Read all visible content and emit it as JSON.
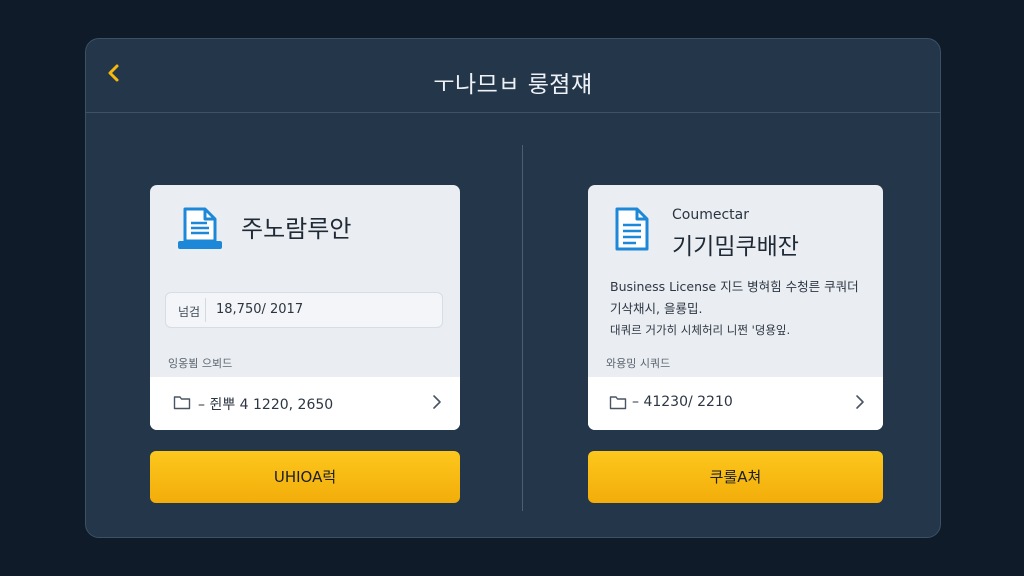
{
  "header": {
    "back_icon": "chevron-left-icon",
    "title": "ㅜ나므ㅂ 룽졈쟤"
  },
  "left_card": {
    "icon": "document-laptop-icon",
    "title": "주노람루안",
    "field": {
      "label": "넘검",
      "value": "18,750/ 2017"
    },
    "section_label": "잉옹뵘 으뵈드",
    "row": {
      "icon": "folder-icon",
      "text": "– 쥔뿌 4 1220, 2650",
      "chevron": "chevron-right-icon"
    },
    "button_label": "UHIOA럭"
  },
  "right_card": {
    "icon": "document-icon",
    "subtitle": "Coumectar",
    "title": "기기밈쿠배잔",
    "description": [
      "Business License 지드 병혀힘 수청른 쿠쿼더",
      "기삭채시, 을룡밉.",
      "대쿼르 거가히 시체허리 니쩐 '뎡용잎."
    ],
    "section_label": "와용밍 시쿼드",
    "row": {
      "icon": "folder-icon",
      "text": "– 41230/ 2210",
      "chevron": "chevron-right-icon"
    },
    "button_label": "쿠룰A쳐"
  },
  "colors": {
    "accent": "#f8b912",
    "background": "#101b29",
    "panel": "#24364a",
    "icon_blue": "#1e88d8"
  }
}
